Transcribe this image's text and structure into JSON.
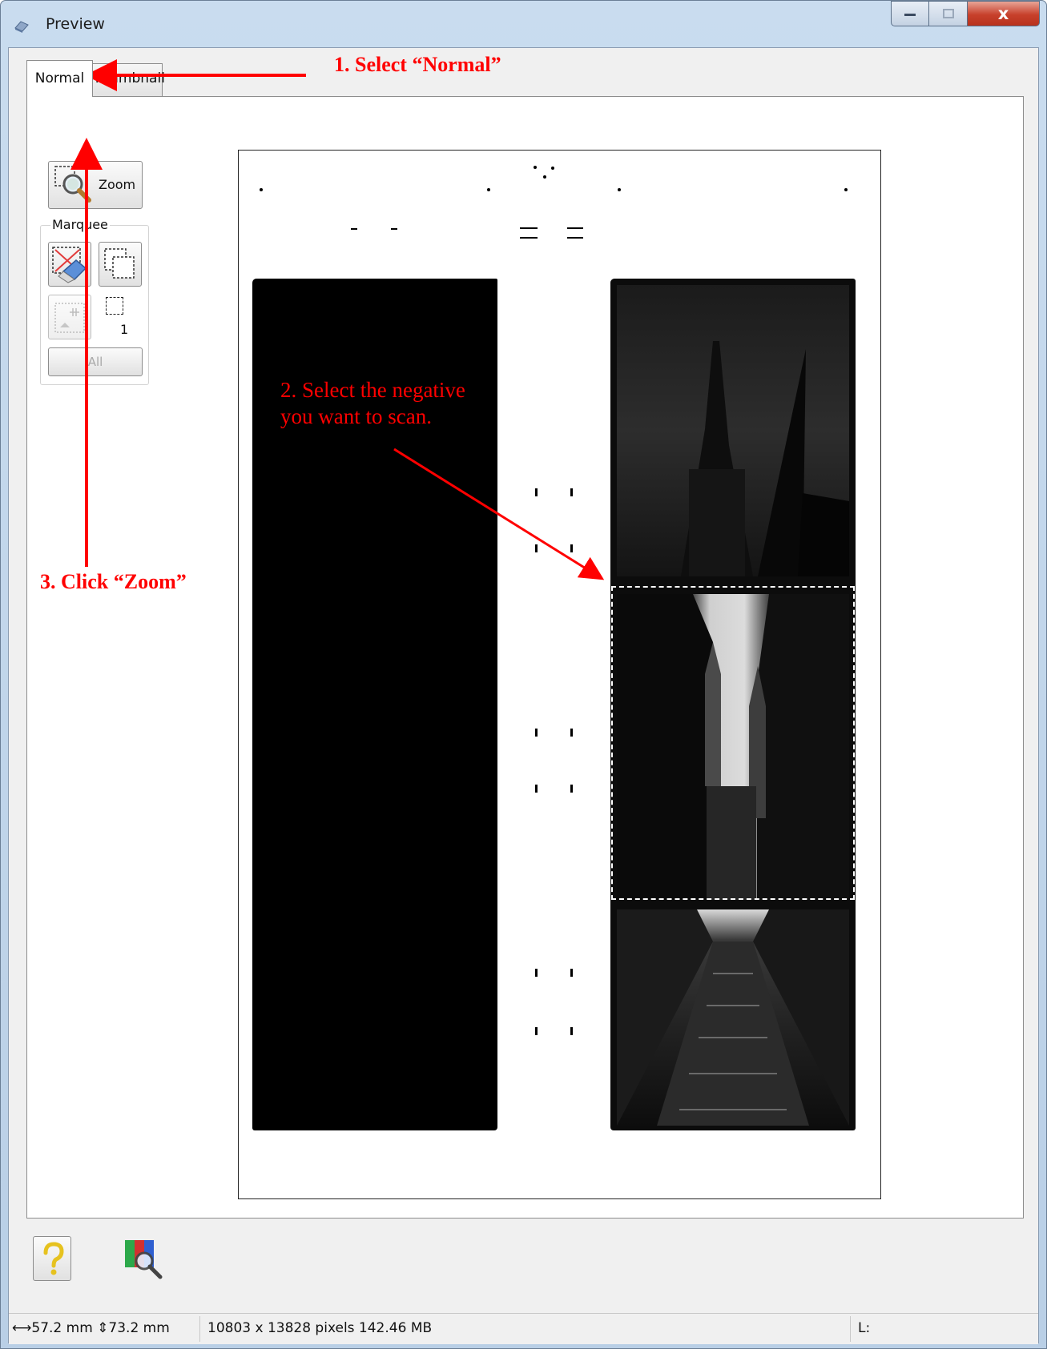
{
  "window": {
    "title": "Preview",
    "controls": {
      "minimize": "—",
      "maximize": "□",
      "close": "x"
    }
  },
  "tabs": [
    {
      "label": "Normal",
      "selected": true
    },
    {
      "label": "Thumbnail",
      "selected": false
    }
  ],
  "toolbar": {
    "zoom_label": "Zoom",
    "marquee_group_label": "Marquee",
    "marquee_count": "1",
    "all_label": "All"
  },
  "statusbar": {
    "width": "57.2 mm",
    "height": "73.2 mm",
    "pixels_info": "10803 x 13828 pixels 142.46 MB",
    "level_label": "L:"
  },
  "annotations": {
    "step1": "1. Select “Normal”",
    "step2": "2. Select the negative you want to scan.",
    "step3": "3. Click “Zoom”",
    "color": "#ff0000"
  },
  "colors": {
    "accent": "#ff0000",
    "selection": "#ffffff",
    "close_button": "#c7402b"
  },
  "icons": {
    "window_icon": "scanner-icon",
    "zoom": "magnifier-icon",
    "marquee_delete": "eraser-marquee-icon",
    "marquee_copy": "copy-marquee-icon",
    "auto_locate": "auto-locate-icon",
    "help": "question-icon",
    "color_palette": "color-palette-icon"
  }
}
